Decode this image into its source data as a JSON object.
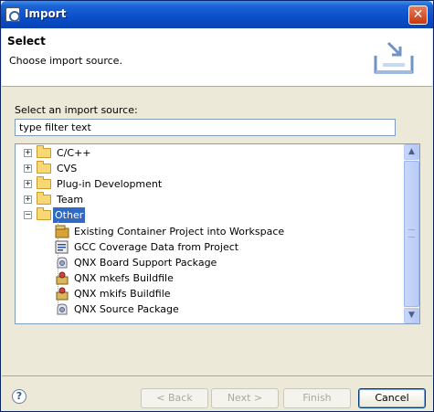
{
  "window": {
    "title": "Import"
  },
  "header": {
    "title": "Select",
    "description": "Choose import source."
  },
  "source_label": "Select an import source:",
  "filter": {
    "value": "type filter text"
  },
  "tree": {
    "folders": [
      {
        "label": "C/C++",
        "expanded": false
      },
      {
        "label": "CVS",
        "expanded": false
      },
      {
        "label": "Plug-in Development",
        "expanded": false
      },
      {
        "label": "Team",
        "expanded": false
      },
      {
        "label": "Other",
        "expanded": true,
        "selected": true
      }
    ],
    "items": [
      {
        "label": "Existing Container Project into Workspace",
        "icon": "container-project-icon"
      },
      {
        "label": "GCC Coverage Data from Project",
        "icon": "coverage-data-icon"
      },
      {
        "label": "QNX Board Support Package",
        "icon": "bsp-package-icon"
      },
      {
        "label": "QNX mkefs Buildfile",
        "icon": "buildfile-icon"
      },
      {
        "label": "QNX mkifs Buildfile",
        "icon": "buildfile-icon"
      },
      {
        "label": "QNX Source Package",
        "icon": "source-package-icon"
      }
    ]
  },
  "buttons": {
    "back": "< Back",
    "next": "Next >",
    "finish": "Finish",
    "cancel": "Cancel"
  },
  "help": "?"
}
